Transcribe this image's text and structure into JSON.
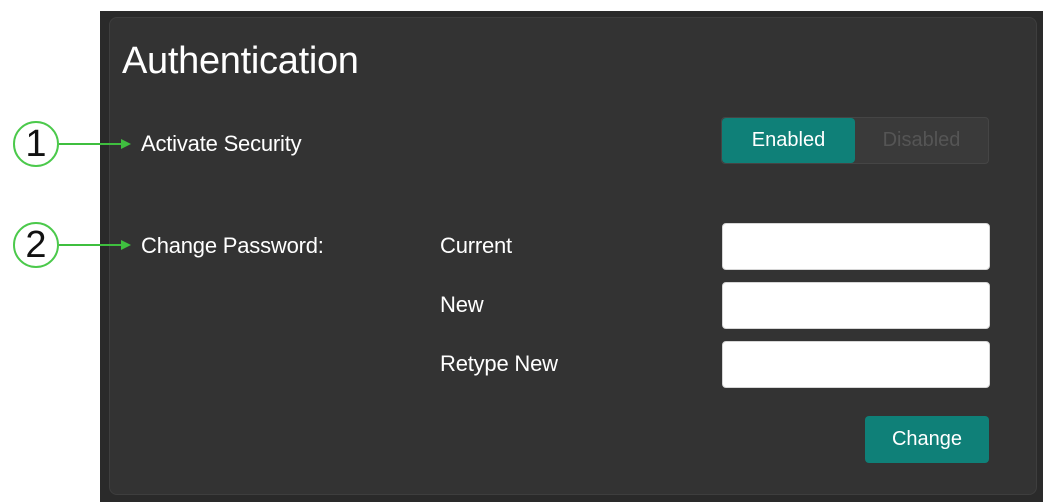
{
  "panel": {
    "title": "Authentication"
  },
  "security": {
    "label": "Activate Security",
    "options": [
      "Enabled",
      "Disabled"
    ],
    "selected": "Enabled"
  },
  "password": {
    "label": "Change Password:",
    "fields": [
      {
        "label": "Current",
        "value": ""
      },
      {
        "label": "New",
        "value": ""
      },
      {
        "label": "Retype New",
        "value": ""
      }
    ],
    "change_label": "Change"
  },
  "callouts": [
    "1",
    "2"
  ],
  "colors": {
    "accent": "#0f8078",
    "panel_bg": "#333333",
    "callout_green": "#3fbf3f"
  }
}
